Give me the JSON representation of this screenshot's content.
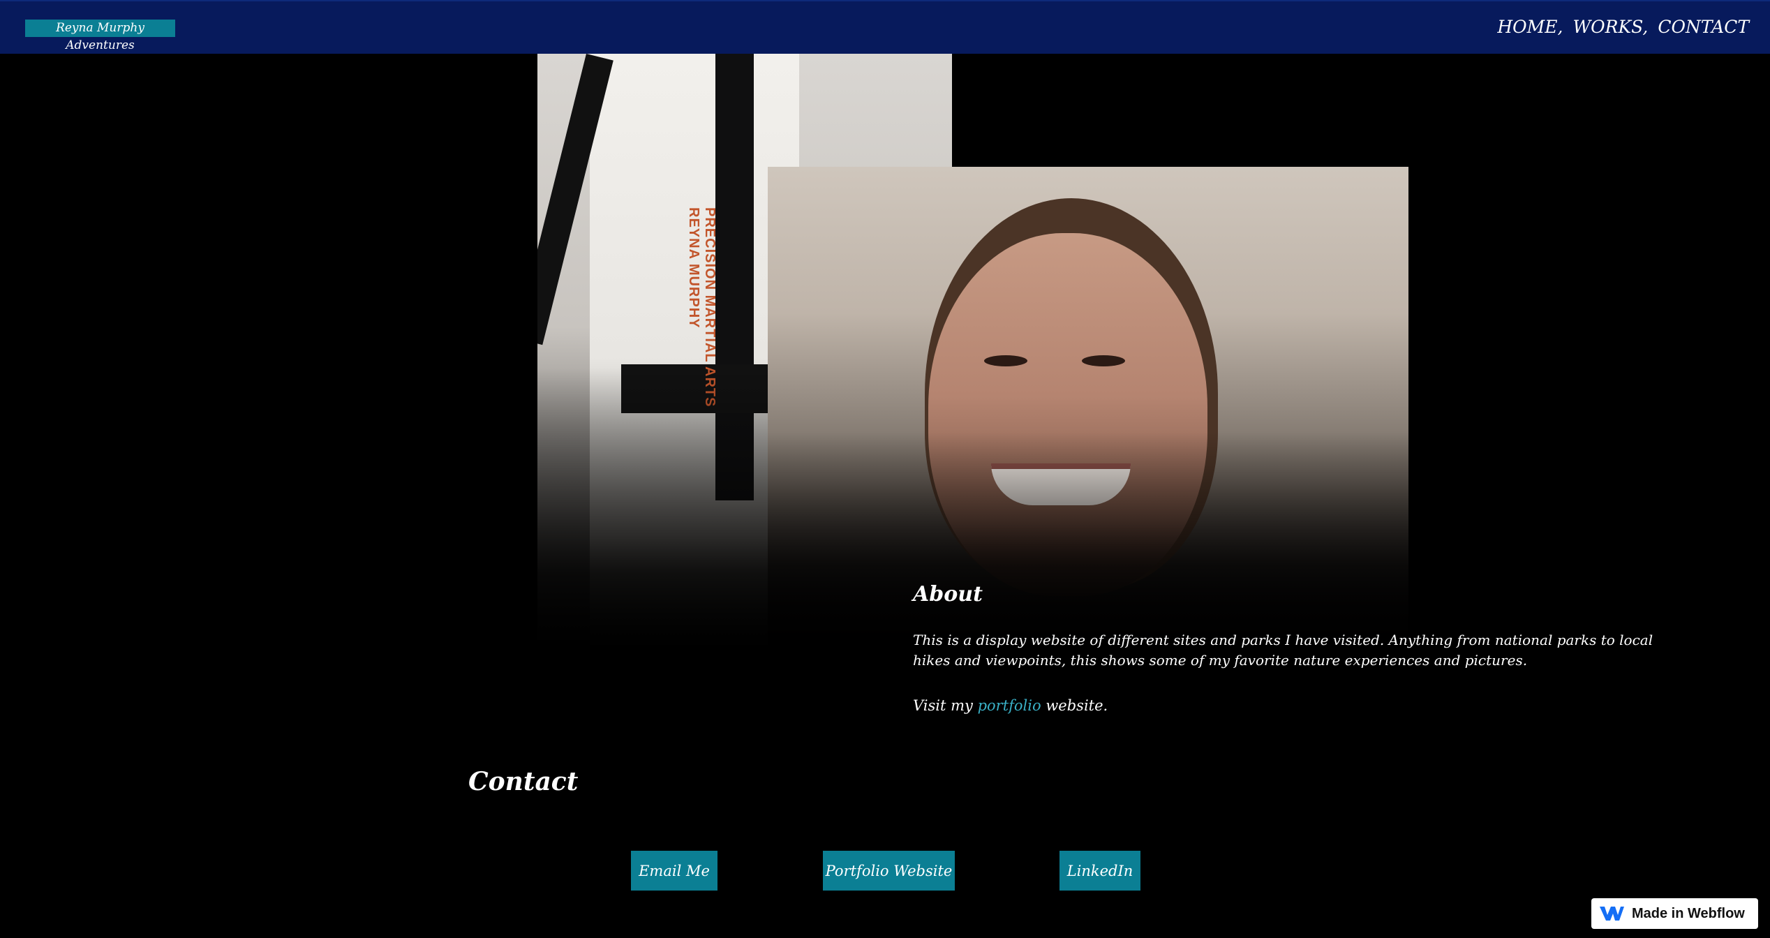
{
  "navbar": {
    "brand": "Reyna Murphy Adventures",
    "links": [
      {
        "label": "HOME,"
      },
      {
        "label": "WORKS,"
      },
      {
        "label": "CONTACT"
      }
    ]
  },
  "photos": {
    "karate": {
      "belt_lines": [
        "PRECISION MARTIAL ARTS",
        "REYNA MURPHY"
      ]
    }
  },
  "about": {
    "heading": "About",
    "body": "This is a display website of different sites and parks I have visited. Anything from national parks to local hikes and viewpoints, this shows some of my favorite nature experiences and pictures.",
    "visit_prefix": "Visit my ",
    "visit_link": "portfolio",
    "visit_suffix": " website."
  },
  "contact": {
    "heading": "Contact",
    "buttons": [
      {
        "label": "Email Me"
      },
      {
        "label": "Portfolio Website"
      },
      {
        "label": "LinkedIn"
      }
    ]
  },
  "badge": {
    "label": "Made in Webflow"
  },
  "colors": {
    "navbar": "#071a5c",
    "accent": "#0b7f94",
    "link": "#3ab1c7",
    "background": "#000000"
  }
}
